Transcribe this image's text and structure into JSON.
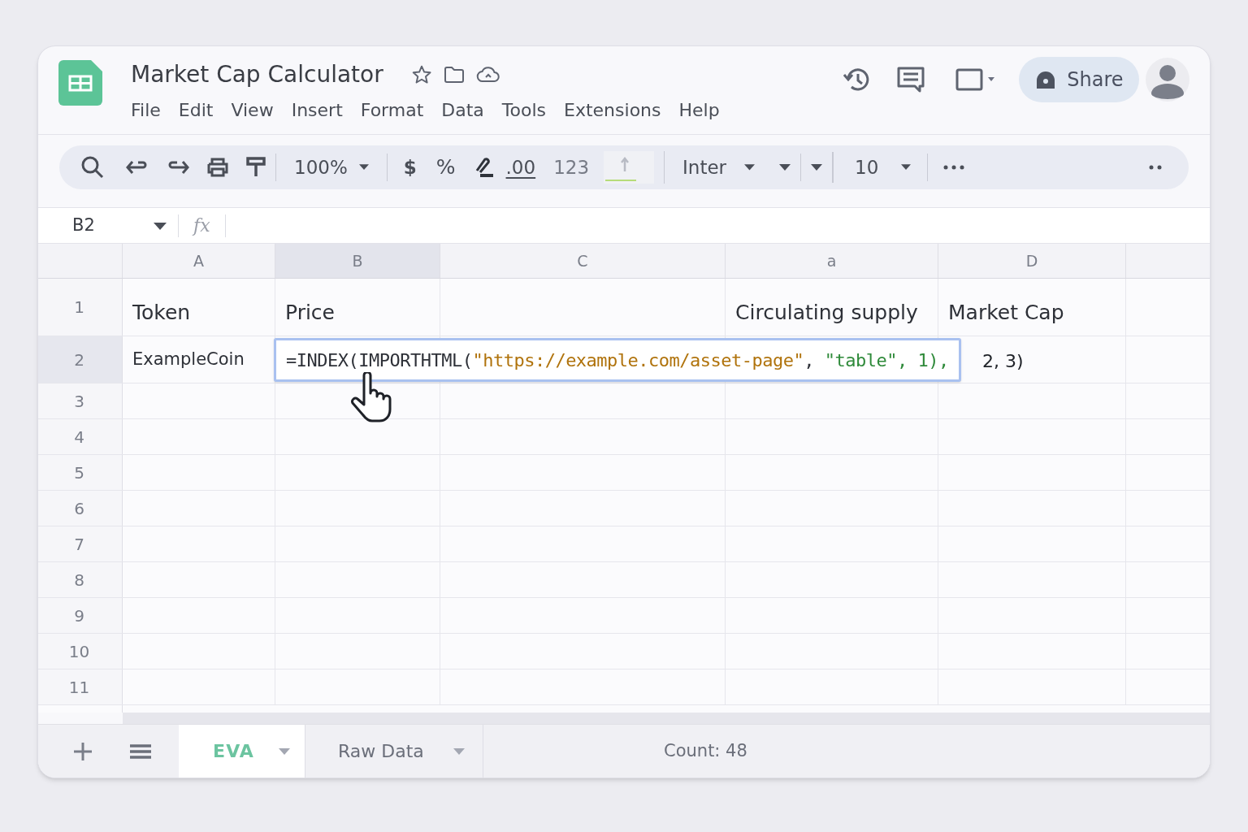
{
  "app": {
    "title": "Market Cap Calculator",
    "menu": [
      "File",
      "Edit",
      "View",
      "Insert",
      "Format",
      "Data",
      "Tools",
      "Extensions",
      "Help"
    ]
  },
  "share_button": {
    "label": "Share"
  },
  "toolbar": {
    "zoom": "100%",
    "currency": "$",
    "percent": "%",
    "decimal": ".00",
    "number_format": "123",
    "font": "Inter",
    "font_size": "10"
  },
  "name_box": {
    "value": "B2"
  },
  "formula_bar": {
    "function_label": "fx"
  },
  "grid": {
    "columns": [
      {
        "label": "A",
        "selected": false
      },
      {
        "label": "B",
        "selected": true
      },
      {
        "label": "C",
        "selected": false
      },
      {
        "label": "a",
        "selected": false
      },
      {
        "label": "D",
        "selected": false
      }
    ],
    "rows": [
      {
        "number": "1",
        "selected": false,
        "cells": [
          "Token",
          "Price",
          null,
          "Circulating supply",
          "Market Cap"
        ]
      },
      {
        "number": "2",
        "selected": true,
        "cells": [
          "ExampleCoin"
        ]
      },
      {
        "number": "3",
        "selected": false
      },
      {
        "number": "4",
        "selected": false
      },
      {
        "number": "5",
        "selected": false
      },
      {
        "number": "6",
        "selected": false
      },
      {
        "number": "7",
        "selected": false
      },
      {
        "number": "8",
        "selected": false
      },
      {
        "number": "9",
        "selected": false
      },
      {
        "number": "10",
        "selected": false
      },
      {
        "number": "11",
        "selected": false
      }
    ]
  },
  "editor": {
    "segments": [
      {
        "kind": "plain",
        "text": "=INDEX(IMPORTHTML("
      },
      {
        "kind": "url",
        "text": "\"https://example.com/asset-page\""
      },
      {
        "kind": "plain",
        "text": ", "
      },
      {
        "kind": "string",
        "text": "\"table\", 1),"
      }
    ],
    "overflow_text": "2, 3)"
  },
  "sheet_tabs": [
    {
      "label": "EVA",
      "selected": true
    },
    {
      "label": "Raw Data",
      "selected": false
    }
  ],
  "status": {
    "summary": "Count: 48"
  }
}
